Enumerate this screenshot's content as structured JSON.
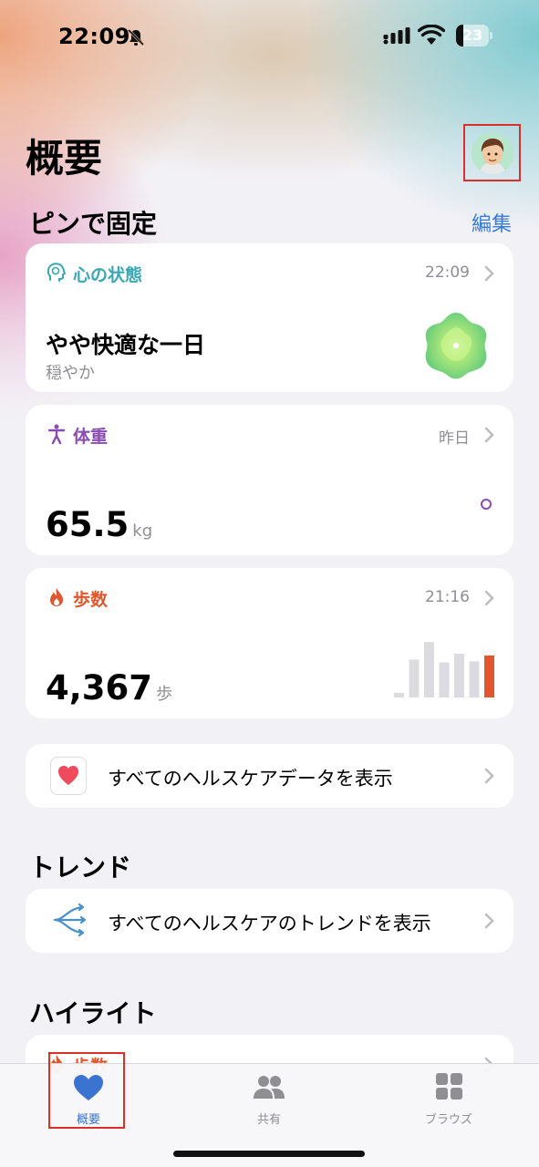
{
  "status_bar": {
    "time": "22:09",
    "battery": "23",
    "battery_percent": 23
  },
  "header": {
    "title": "概要"
  },
  "pinned": {
    "heading": "ピンで固定",
    "edit_label": "編集",
    "mood": {
      "title": "心の状態",
      "time": "22:09",
      "value": "やや快適な一日",
      "subtitle": "穏やか",
      "color": "#3aa7b5"
    },
    "weight": {
      "title": "体重",
      "time": "昨日",
      "value": "65.5",
      "unit": "kg",
      "color": "#8a4bb3"
    },
    "steps": {
      "title": "歩数",
      "time": "21:16",
      "value": "4,367",
      "unit": "歩",
      "color": "#e0562d",
      "bar_levels": [
        0.08,
        0.65,
        0.95,
        0.6,
        0.75,
        0.62,
        0.72
      ]
    },
    "show_all": "すべてのヘルスケアデータを表示"
  },
  "trends": {
    "heading": "トレンド",
    "show_all": "すべてのヘルスケアのトレンドを表示"
  },
  "highlights": {
    "heading": "ハイライト",
    "peek_title": "歩数"
  },
  "tabs": [
    {
      "label": "概要",
      "icon": "heart-icon"
    },
    {
      "label": "共有",
      "icon": "people-icon"
    },
    {
      "label": "ブラウズ",
      "icon": "grid-icon"
    }
  ]
}
